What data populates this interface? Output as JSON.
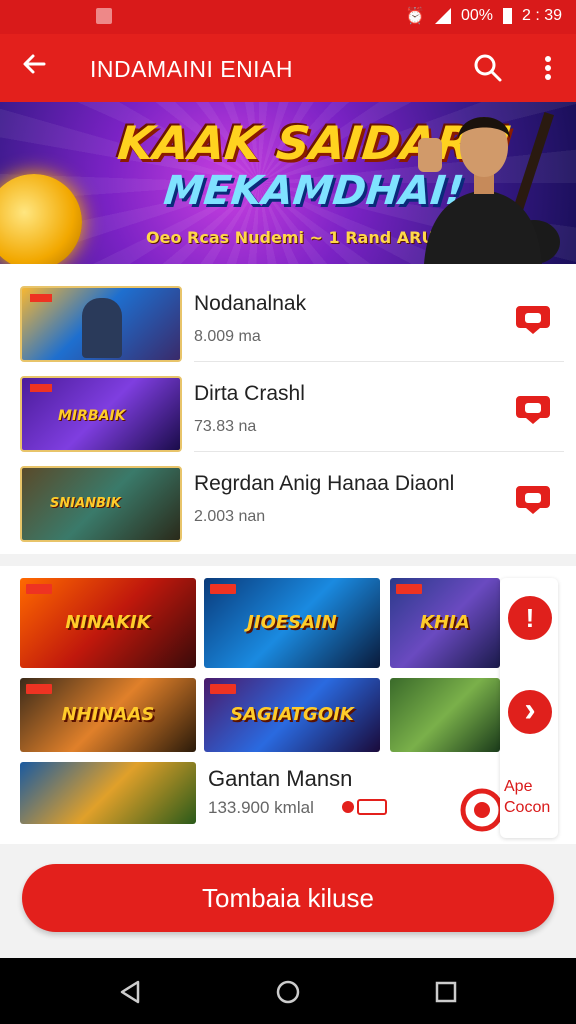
{
  "status_bar": {
    "battery_text": "00%",
    "time": "2 : 39",
    "signal_icon": "signal-icon",
    "alarm_icon": "alarm-icon",
    "battery_icon": "battery-icon"
  },
  "app_bar": {
    "title": "INDAMAINI ENIAH",
    "back_icon": "back-arrow-icon",
    "search_icon": "search-icon",
    "more_icon": "more-vert-icon"
  },
  "banner": {
    "headline": "KAAK SAIDARN",
    "subheadline": "MEKAMDHAI!",
    "tagline": "Oeo Rcas Nudemi ~ 1 Rand ARUS"
  },
  "list": {
    "items": [
      {
        "title": "Nodanalnak",
        "meta": "8.009 ma"
      },
      {
        "title": "Dirta Crashl",
        "meta": "73.83 na"
      },
      {
        "title": "Regrdan Anig Hanaa Diaonl",
        "meta": "2.003 nan"
      }
    ]
  },
  "grid": {
    "tiles": [
      {
        "label": "NINAKIK"
      },
      {
        "label": "JIOESAIN"
      },
      {
        "label": "KHIA"
      },
      {
        "label": "NHINAAS"
      },
      {
        "label": "SAGIATGOIK"
      },
      {
        "label": ""
      },
      {
        "label": ""
      }
    ],
    "last_row": {
      "title": "Gantan Mansn",
      "meta": "133.900 kmlal"
    }
  },
  "side_panel": {
    "alert_label": "!",
    "next_label": "›",
    "text_line1": "Ape",
    "text_line2": "Cocon"
  },
  "cta": {
    "label": "Tombaia kiluse"
  },
  "nav_bar": {
    "back_icon": "nav-back-icon",
    "home_icon": "nav-home-icon",
    "recents_icon": "nav-recents-icon"
  },
  "colors": {
    "primary": "#e3201c",
    "status_bar": "#d91a1a",
    "background": "#f2f2f2",
    "banner_purple": "#7a22c4"
  }
}
